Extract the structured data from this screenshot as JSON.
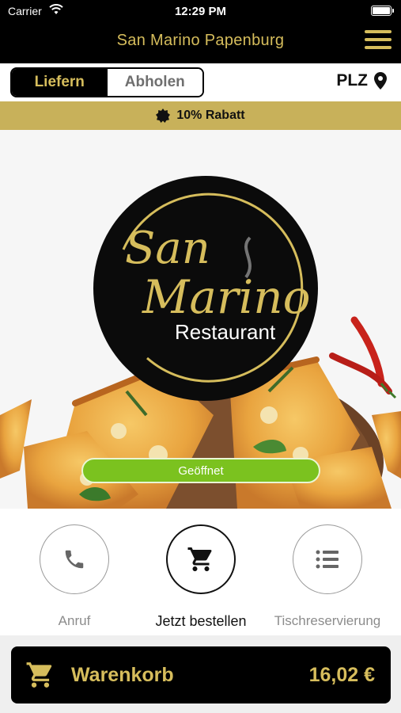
{
  "status_bar": {
    "carrier": "Carrier",
    "time": "12:29 PM"
  },
  "header": {
    "title": "San Marino Papenburg"
  },
  "mode": {
    "deliver": "Liefern",
    "pickup": "Abholen",
    "selected": "Liefern"
  },
  "plz": {
    "label": "PLZ"
  },
  "discount": {
    "text": "10% Rabatt"
  },
  "hero": {
    "logo_line1": "San",
    "logo_line2": "Marino",
    "logo_line3": "Restaurant",
    "status_button": "Geöffnet"
  },
  "actions": [
    {
      "label": "Anruf",
      "icon": "phone-icon"
    },
    {
      "label": "Jetzt bestellen",
      "icon": "cart-icon"
    },
    {
      "label": "Tischreservierung",
      "icon": "list-icon"
    }
  ],
  "cart": {
    "label": "Warenkorb",
    "total": "16,02 €"
  },
  "colors": {
    "gold": "#d6bd5c",
    "banner": "#c8b15a",
    "open": "#7bc21f",
    "black": "#000000"
  }
}
